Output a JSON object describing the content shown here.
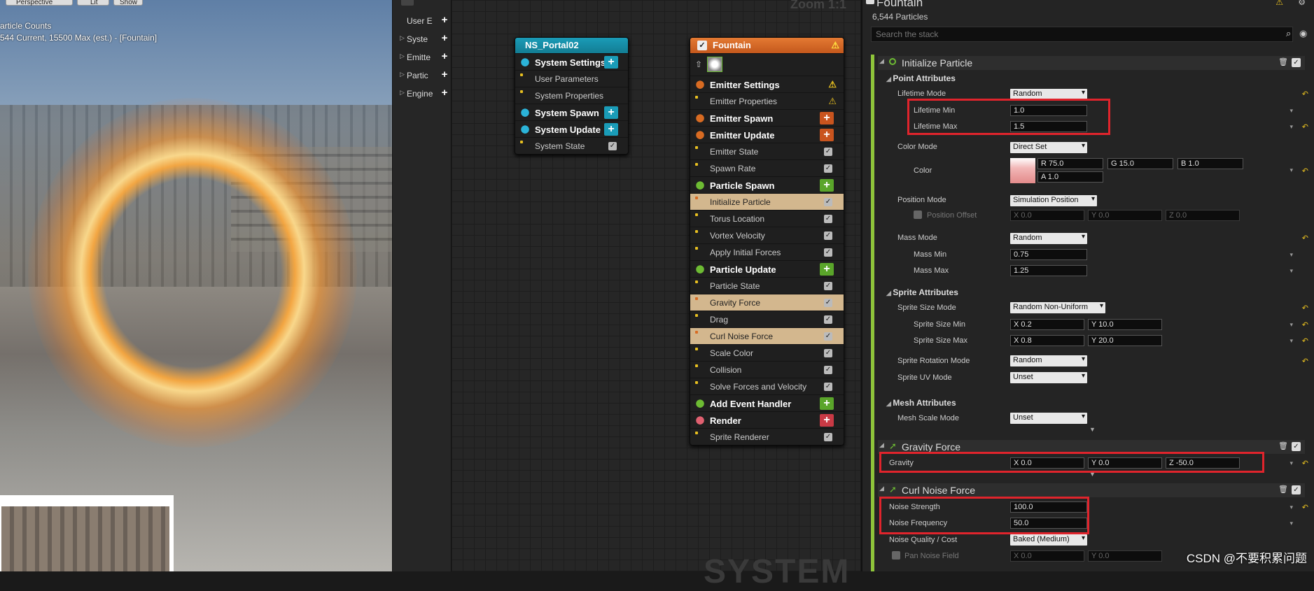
{
  "viewport": {
    "top_buttons": [
      "Perspective",
      "Lit",
      "Show"
    ],
    "stats_title": "article Counts",
    "stats_line": "544 Current, 15500 Max (est.) - [Fountain]"
  },
  "left_panel": {
    "items": [
      {
        "label": "User E",
        "arrow": false
      },
      {
        "label": "Syste",
        "arrow": true
      },
      {
        "label": "Emitte",
        "arrow": true
      },
      {
        "label": "Partic",
        "arrow": true
      },
      {
        "label": "Engine",
        "arrow": true
      }
    ]
  },
  "graph": {
    "zoom_label": "Zoom 1:1",
    "watermark": "SYSTEM",
    "system_node": {
      "title": "NS_Portal02",
      "rows": [
        {
          "label": "System Settings",
          "big": true,
          "add": true
        },
        {
          "label": "User Parameters",
          "big": false
        },
        {
          "label": "System Properties",
          "big": false
        },
        {
          "label": "System Spawn",
          "big": true,
          "add": true
        },
        {
          "label": "System Update",
          "big": true,
          "add": true
        },
        {
          "label": "System State",
          "big": false,
          "check": true
        }
      ]
    },
    "emitter_node": {
      "title": "Fountain",
      "rows": [
        {
          "label": "Emitter Settings",
          "big": true,
          "warn": true,
          "icon": "emitter-icon",
          "color": "#d86b22"
        },
        {
          "label": "Emitter Properties",
          "big": false,
          "warn": true
        },
        {
          "label": "Emitter Spawn",
          "big": true,
          "add": true,
          "addColor": "#c9541e",
          "color": "#d86b22"
        },
        {
          "label": "Emitter Update",
          "big": true,
          "add": true,
          "addColor": "#c9541e",
          "color": "#d86b22"
        },
        {
          "label": "Emitter State",
          "check": true
        },
        {
          "label": "Spawn Rate",
          "check": true
        },
        {
          "label": "Particle Spawn",
          "big": true,
          "add": true,
          "addColor": "#5aa52a",
          "color": "#6dbb33"
        },
        {
          "label": "Initialize Particle",
          "check": true,
          "selected": true
        },
        {
          "label": "Torus Location",
          "check": true
        },
        {
          "label": "Vortex Velocity",
          "check": true
        },
        {
          "label": "Apply Initial Forces",
          "check": true
        },
        {
          "label": "Particle Update",
          "big": true,
          "add": true,
          "addColor": "#5aa52a",
          "color": "#6dbb33"
        },
        {
          "label": "Particle State",
          "check": true
        },
        {
          "label": "Gravity Force",
          "check": true,
          "selected": true
        },
        {
          "label": "Drag",
          "check": true
        },
        {
          "label": "Curl Noise Force",
          "check": true,
          "selected": true
        },
        {
          "label": "Scale Color",
          "check": true
        },
        {
          "label": "Collision",
          "check": true
        },
        {
          "label": "Solve Forces and Velocity",
          "check": true
        },
        {
          "label": "Add Event Handler",
          "big": true,
          "add": true,
          "addColor": "#5aa52a",
          "color": "#6dbb33"
        },
        {
          "label": "Render",
          "big": true,
          "add": true,
          "addColor": "#c93a45",
          "color": "#e06070"
        },
        {
          "label": "Sprite Renderer",
          "check": true
        }
      ]
    }
  },
  "details": {
    "title": "Fountain",
    "particle_count": "6,544 Particles",
    "search_placeholder": "Search the stack",
    "initialize_particle": {
      "header": "Initialize Particle",
      "point_attributes": "Point Attributes",
      "lifetime_mode_label": "Lifetime Mode",
      "lifetime_mode": "Random",
      "lifetime_min_label": "Lifetime Min",
      "lifetime_min": "1.0",
      "lifetime_max_label": "Lifetime Max",
      "lifetime_max": "1.5",
      "color_mode_label": "Color Mode",
      "color_mode": "Direct Set",
      "color_label": "Color",
      "color_r": "R  75.0",
      "color_g": "G  15.0",
      "color_b": "B  1.0",
      "color_a": "A  1.0",
      "position_mode_label": "Position Mode",
      "position_mode": "Simulation Position",
      "position_offset_label": "Position Offset",
      "pos_x": "X  0.0",
      "pos_y": "Y  0.0",
      "pos_z": "Z  0.0",
      "mass_mode_label": "Mass Mode",
      "mass_mode": "Random",
      "mass_min_label": "Mass Min",
      "mass_min": "0.75",
      "mass_max_label": "Mass Max",
      "mass_max": "1.25",
      "sprite_attributes": "Sprite Attributes",
      "sprite_size_mode_label": "Sprite Size Mode",
      "sprite_size_mode": "Random Non-Uniform",
      "sprite_size_min_label": "Sprite Size Min",
      "ssmin_x": "X  0.2",
      "ssmin_y": "Y  10.0",
      "sprite_size_max_label": "Sprite Size Max",
      "ssmax_x": "X  0.8",
      "ssmax_y": "Y  20.0",
      "sprite_rot_label": "Sprite Rotation Mode",
      "sprite_rot": "Random",
      "sprite_uv_label": "Sprite UV Mode",
      "sprite_uv": "Unset",
      "mesh_attributes": "Mesh Attributes",
      "mesh_scale_label": "Mesh Scale Mode",
      "mesh_scale": "Unset"
    },
    "gravity_force": {
      "header": "Gravity Force",
      "gravity_label": "Gravity",
      "x": "X  0.0",
      "y": "Y  0.0",
      "z": "Z  -50.0"
    },
    "curl_noise": {
      "header": "Curl Noise Force",
      "strength_label": "Noise Strength",
      "strength": "100.0",
      "frequency_label": "Noise Frequency",
      "frequency": "50.0",
      "quality_label": "Noise Quality / Cost",
      "quality": "Baked (Medium)",
      "pan_label": "Pan Noise Field",
      "pan_x": "X  0.0",
      "pan_y": "Y  0.0"
    }
  },
  "watermark_csdn": "CSDN @不要积累问题",
  "colors": {
    "accent_green": "#8ec43a",
    "highlight_red": "#e0242c",
    "selected_row": "#d3b78e"
  }
}
